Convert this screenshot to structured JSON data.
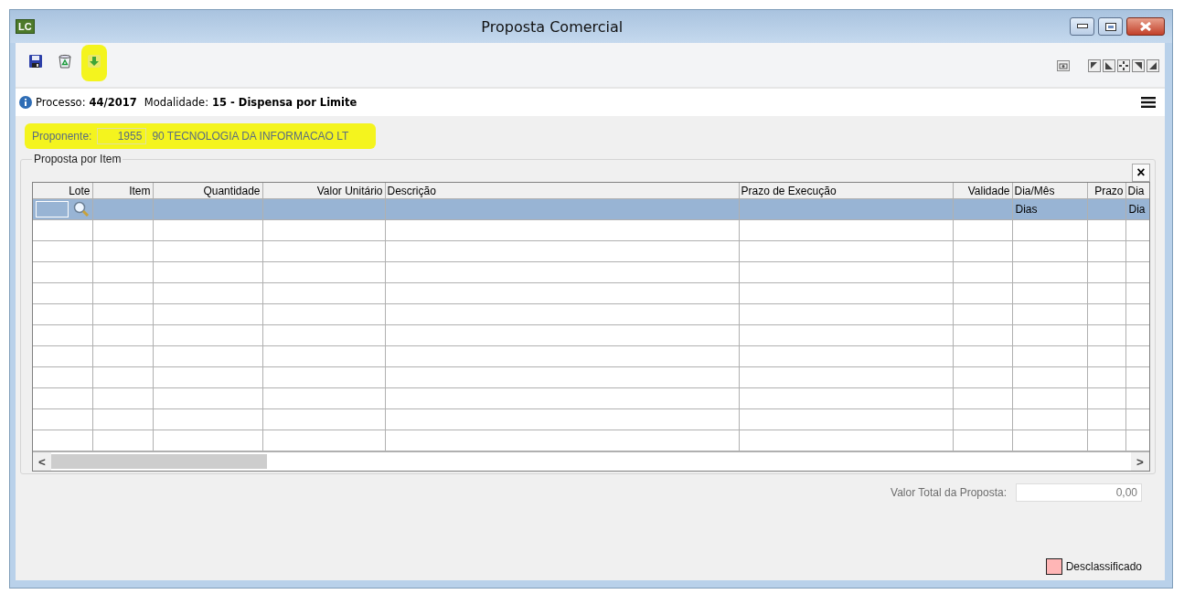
{
  "window": {
    "title": "Proposta Comercial",
    "app_badge": "LC"
  },
  "toolbar": {
    "buttons": [
      {
        "kind": "save",
        "highlighted": false
      },
      {
        "kind": "trash",
        "highlighted": false
      },
      {
        "kind": "download",
        "highlighted": true
      }
    ]
  },
  "info": {
    "process_label": "Processo:",
    "process_value": "44/2017",
    "modality_label": "Modalidade:",
    "modality_value": "15 - Dispensa por Limite"
  },
  "bidder": {
    "label": "Proponente:",
    "code": "1955",
    "name": "90 TECNOLOGIA DA INFORMACAO LT",
    "highlighted": true
  },
  "group": {
    "title": "Proposta por Item",
    "close": "×"
  },
  "table": {
    "columns": [
      {
        "label": "Lote"
      },
      {
        "label": "Item"
      },
      {
        "label": "Quantidade"
      },
      {
        "label": "Valor Unitário"
      },
      {
        "label": "Descrição"
      },
      {
        "label": "Prazo de Execução"
      },
      {
        "label": "Validade"
      },
      {
        "label": "Dia/Mês"
      },
      {
        "label": "Prazo"
      },
      {
        "label": "Dia"
      }
    ],
    "rows": [
      {
        "selected": true,
        "cells": {
          "7": "Dias",
          "9": "Dia"
        }
      },
      {
        "selected": false
      },
      {
        "selected": false
      },
      {
        "selected": false
      },
      {
        "selected": false
      },
      {
        "selected": false
      },
      {
        "selected": false
      },
      {
        "selected": false
      },
      {
        "selected": false
      },
      {
        "selected": false
      },
      {
        "selected": false
      },
      {
        "selected": false
      }
    ],
    "scroll_left": "<",
    "scroll_right": ">"
  },
  "total": {
    "label": "Valor Total da Proposta:",
    "value": "0,00"
  },
  "legend": [
    {
      "label": "Desclassificado",
      "color": "#ffb6b6"
    }
  ]
}
